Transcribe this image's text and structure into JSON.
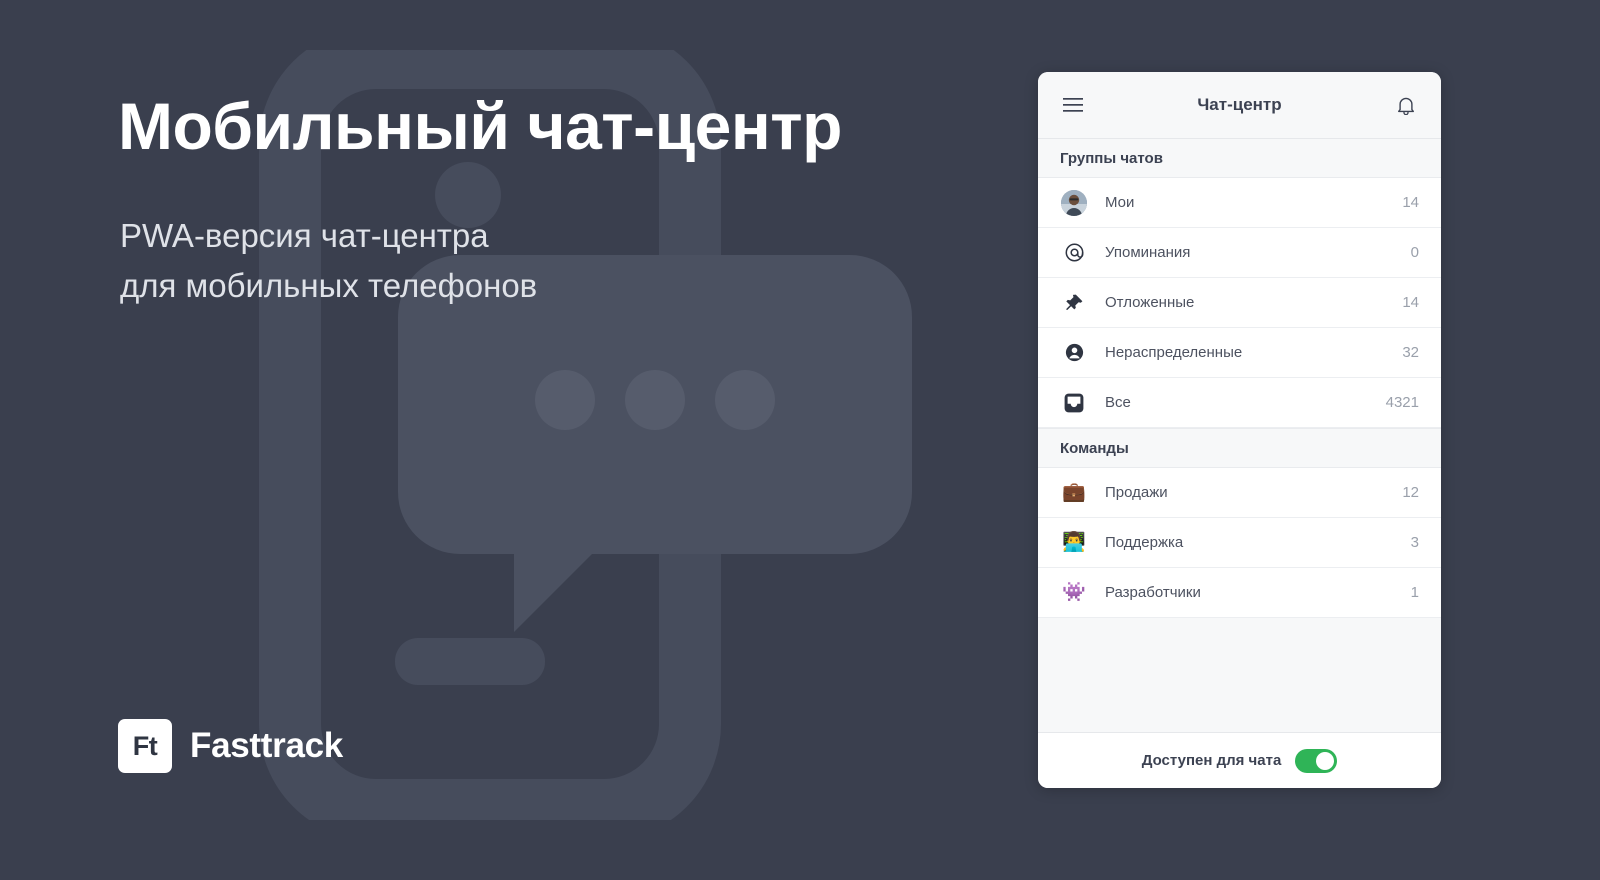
{
  "hero": {
    "title": "Мобильный чат-центр",
    "subtitle_line1": "PWA-версия чат-центра",
    "subtitle_line2": "для мобильных телефонов",
    "brand_mark": "Ft",
    "brand_name": "Fasttrack",
    "background_color": "#3a3f4e",
    "watermark_color": "#464c5c"
  },
  "app": {
    "title": "Чат-центр",
    "menu_icon": "hamburger-menu-icon",
    "bell_icon": "notification-bell-icon",
    "sections": [
      {
        "heading": "Группы чатов",
        "rows": [
          {
            "icon": "user-avatar",
            "label": "Мои",
            "count": "14"
          },
          {
            "icon": "at-sign-icon",
            "label": "Упоминания",
            "count": "0"
          },
          {
            "icon": "pushpin-icon",
            "label": "Отложенные",
            "count": "14"
          },
          {
            "icon": "person-circle-icon",
            "label": "Нераспределенные",
            "count": "32"
          },
          {
            "icon": "inbox-tray-icon",
            "label": "Все",
            "count": "4321"
          }
        ]
      },
      {
        "heading": "Команды",
        "rows": [
          {
            "icon": "briefcase-emoji",
            "label": "Продажи",
            "count": "12"
          },
          {
            "icon": "technologist-emoji",
            "label": "Поддержка",
            "count": "3"
          },
          {
            "icon": "alien-monster-emoji",
            "label": "Разработчики",
            "count": "1"
          }
        ]
      }
    ],
    "status": {
      "label": "Доступен для чата",
      "toggle_on": true,
      "toggle_color": "#2fb457"
    }
  }
}
